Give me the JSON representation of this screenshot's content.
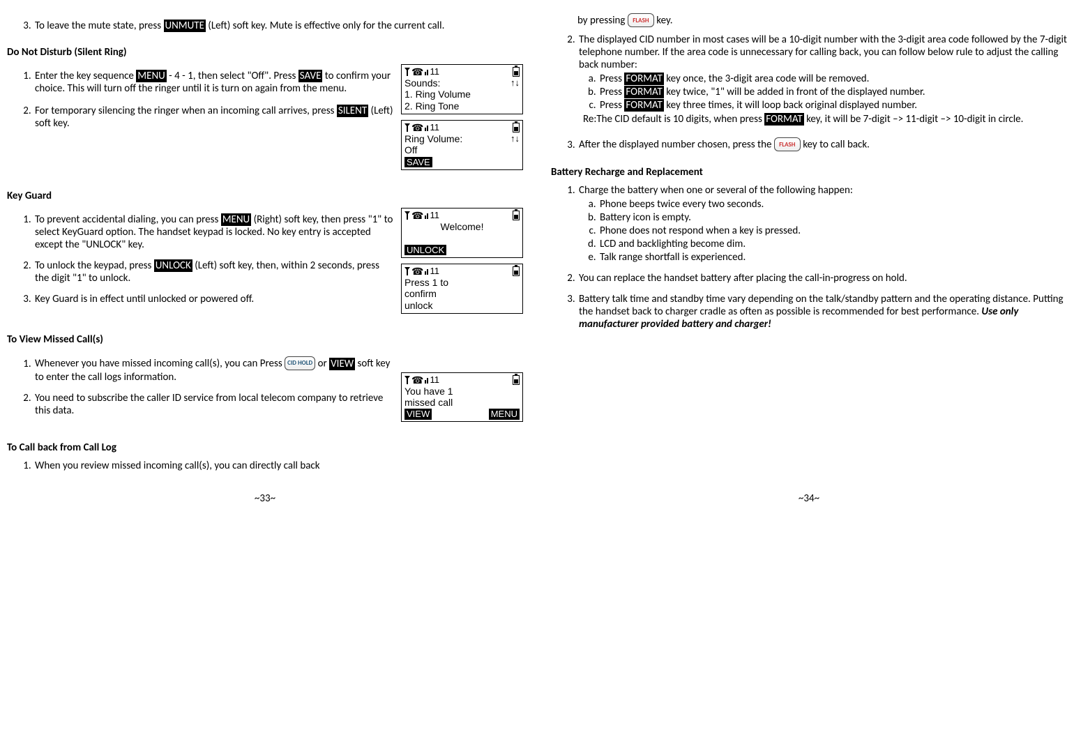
{
  "left": {
    "mute": {
      "item3_pre": "To leave the mute state, press ",
      "unmute": "UNMUTE",
      "item3_post": " (Left) soft key. Mute is effective only for the current call."
    },
    "dnd": {
      "heading": "Do Not Disturb (Silent Ring)",
      "item1_a": "Enter the key sequence ",
      "menu": "MENU",
      "item1_b": " - 4 - 1, then select \"Off\". Press ",
      "save": "SAVE",
      "item1_c": " to confirm your choice. This will turn off the ringer until it is turn on again from the menu.",
      "item2_a": "For temporary silencing the ringer when an incoming call arrives, press ",
      "silent": "SILENT",
      "item2_b": " (Left) soft key.",
      "lcd1": {
        "num": "11",
        "row2l": "Sounds:",
        "row2r": "↑↓",
        "line3": "1. Ring Volume",
        "line4": "2. Ring Tone"
      },
      "lcd2": {
        "num": "11",
        "row2l": "Ring Volume:",
        "row2r": "↑↓",
        "line3": "Off",
        "soft": "SAVE"
      }
    },
    "keyguard": {
      "heading": "Key Guard",
      "item1_a": "To prevent accidental dialing, you can press ",
      "menu": "MENU",
      "item1_b": " (Right) soft key, then press \"1\" to select KeyGuard option.  The handset keypad is locked.  No key entry is accepted except the \"UNLOCK\" key.",
      "item2_a": "To unlock the keypad, press ",
      "unlock": "UNLOCK",
      "item2_b": " (Left) soft key, then, within 2 seconds, press the digit \"1\" to unlock.",
      "item3": "Key Guard is in effect until unlocked or powered off.",
      "lcd1": {
        "num": "11",
        "line2": "Welcome!",
        "soft": "UNLOCK"
      },
      "lcd2": {
        "num": "11",
        "line2": "Press 1 to",
        "line3": "  confirm",
        "line4": "  unlock"
      }
    },
    "missed": {
      "heading": "To View Missed Call(s)",
      "item1_a": "Whenever you have missed incoming call(s), you can Press ",
      "cid": "CID HOLD",
      "item1_b": " or  ",
      "view": "VIEW",
      "item1_c": " soft key to enter the call logs information.",
      "item2": "You need to subscribe the caller ID service from local telecom company to retrieve this data.",
      "lcd": {
        "num": "11",
        "line2": "You have 1",
        "line3": "missed call",
        "softL": "VIEW",
        "softR": "MENU"
      }
    },
    "callback": {
      "heading": "To Call back from Call Log",
      "item1": "When you review missed incoming call(s), you can directly call back"
    },
    "pagenum": "~33~"
  },
  "right": {
    "cont": {
      "part1": "by pressing ",
      "flash": "FLASH",
      "part2": " key."
    },
    "item2": {
      "intro": "The displayed CID number in most cases will be a 10-digit number with the 3-digit area code followed by the 7-digit telephone number. If the area code is unnecessary for calling back, you can follow below rule to adjust the calling back number:",
      "a_pre": "Press ",
      "format": "FORMAT",
      "a_post": " key once, the 3-digit area code will be removed.",
      "b_pre": "Press ",
      "b_post": " key twice, \"1\" will be added in front of the displayed number.",
      "c_pre": "Press ",
      "c_post": " key three times, it will loop back original displayed number.",
      "re_pre": "Re:The CID default is 10 digits,  when press ",
      "re_post": " key, it will be 7-digit –> 11-digit –> 10-digit in circle."
    },
    "item3": {
      "pre": "After the displayed number chosen, press the ",
      "flash": "FLASH",
      "post": " key to call back."
    },
    "battery": {
      "heading": "Battery Recharge and Replacement",
      "item1": "Charge the battery when one or several of the following happen:",
      "a": "Phone beeps twice every two seconds.",
      "b": "Battery icon is empty.",
      "c": "Phone does not respond when a key is pressed.",
      "d": "LCD and backlighting become dim.",
      "e": "Talk range shortfall is experienced.",
      "item2": "You can replace the handset battery after placing the call-in-progress on hold.",
      "item3_a": "Battery talk time and standby time vary depending on the talk/standby pattern and the operating distance.  Putting the handset back to charger cradle as often as possible is recommended for best performance. ",
      "item3_b": "Use only manufacturer provided battery and charger!"
    },
    "pagenum": "~34~"
  }
}
